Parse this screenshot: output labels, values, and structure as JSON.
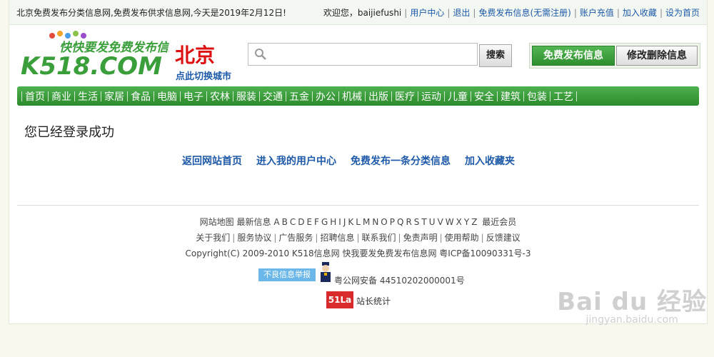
{
  "topbar": {
    "welcome_text": "北京免费发布分类信息网,免费发布供求信息网,今天是2019年2月12日!",
    "greeting": "欢迎您，baijiefushi",
    "links": [
      "用户中心",
      "退出",
      "免费发布信息(无需注册)",
      "账户充值",
      "加入收藏",
      "设为首页"
    ]
  },
  "logo": {
    "brand": "K518.COM",
    "slogan": "快快要发免费发布信息"
  },
  "city": {
    "name": "北京",
    "switch_label": "点此切换城市"
  },
  "search": {
    "placeholder": "",
    "button_label": "搜索"
  },
  "header_buttons": {
    "post_label": "免费发布信息",
    "edit_label": "修改删除信息"
  },
  "nav": {
    "items": [
      "首页",
      "商业",
      "生活",
      "家居",
      "食品",
      "电脑",
      "电子",
      "农林",
      "服装",
      "交通",
      "五金",
      "办公",
      "机械",
      "出版",
      "医疗",
      "运动",
      "儿童",
      "安全",
      "建筑",
      "包装",
      "工艺"
    ]
  },
  "main": {
    "message": "您已经登录成功",
    "actions": [
      "返回网站首页",
      "进入我的用户中心",
      "免费发布一条分类信息",
      "加入收藏夹"
    ]
  },
  "footer": {
    "index_prefix": [
      "网站地图",
      "最新信息"
    ],
    "letters": [
      "A",
      "B",
      "C",
      "D",
      "E",
      "F",
      "G",
      "H",
      "I",
      "J",
      "K",
      "L",
      "M",
      "N",
      "O",
      "P",
      "Q",
      "R",
      "S",
      "T",
      "U",
      "V",
      "W",
      "X",
      "Y",
      "Z"
    ],
    "index_suffix": "最近会员",
    "links": [
      "关于我们",
      "服务协议",
      "广告服务",
      "招聘信息",
      "联系我们",
      "免责声明",
      "使用帮助",
      "反馈建议"
    ],
    "copyright": "Copyright(C) 2009-2010 K518信息网 快我要发免费发布信息网 粤ICP备10090331号-3",
    "report_label": "不良信息举报",
    "police_record": "粤公网安备 44510202000001号",
    "stats_badge": "51La",
    "stats_text": "站长统计"
  },
  "watermark": {
    "brand": "Bai du 经验",
    "url": "jingyan.baidu.com"
  },
  "colors": {
    "nav_green": "#3a9e3a",
    "link_blue": "#1f5aa8",
    "city_red": "#d11111"
  }
}
